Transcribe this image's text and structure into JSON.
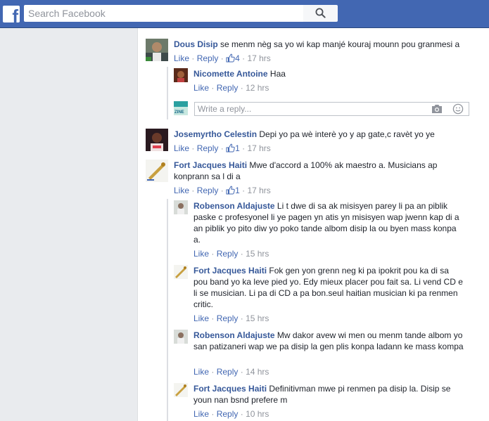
{
  "header": {
    "logo_letter": "f",
    "search_placeholder": "Search Facebook"
  },
  "labels": {
    "like": "Like",
    "reply": "Reply",
    "sep": "·"
  },
  "comments": [
    {
      "author": "Dous Disip",
      "text": "se menm nèg sa yo wi kap manjé kouraj mounn pou granmesi a",
      "likes": "4",
      "time": "17 hrs"
    },
    {
      "author": "Nicomette Antoine",
      "text": "Haa",
      "time": "12 hrs"
    },
    {
      "author": "Josemyrtho Celestin",
      "text": "Depi yo pa wè interè yo y ap gate,c ravèt yo ye",
      "likes": "1",
      "time": "17 hrs"
    },
    {
      "author": "Fort Jacques Haiti",
      "text": "Mwe d'accord a 100% ak maestro a. Musicians ap konprann sa l di a",
      "likes": "1",
      "time": "17 hrs"
    },
    {
      "author": "Robenson Aldajuste",
      "text": "Li t dwe di sa ak misisyen parey li pa an piblik paske c profesyonel li ye pagen yn atis yn misisyen wap jwenn kap di a an piblik yo pito diw yo poko tande albom disip la ou byen mass konpa a.",
      "time": "15 hrs"
    },
    {
      "author": "Fort Jacques Haiti",
      "text": "Fok gen yon grenn neg ki pa ipokrit pou ka di sa pou band yo ka leve pied yo. Edy mieux placer pou fait sa. Li vend CD e li se musician. Li pa di CD a pa bon.seul haitian musician ki pa renmen critic.",
      "time": "15 hrs"
    },
    {
      "author": "Robenson Aldajuste",
      "text": "Mw dakor avew wi men ou menm tande albom yo san patizaneri wap we pa disip la gen plis konpa ladann ke mass kompa",
      "time": "14 hrs"
    },
    {
      "author": "Fort Jacques Haiti",
      "text": "Definitivman mwe pi renmen pa disip la. Disip se youn nan bsnd prefere m",
      "time": "10 hrs"
    }
  ],
  "reply_box": {
    "placeholder": "Write a reply...",
    "avatar_label": "ZINE"
  }
}
